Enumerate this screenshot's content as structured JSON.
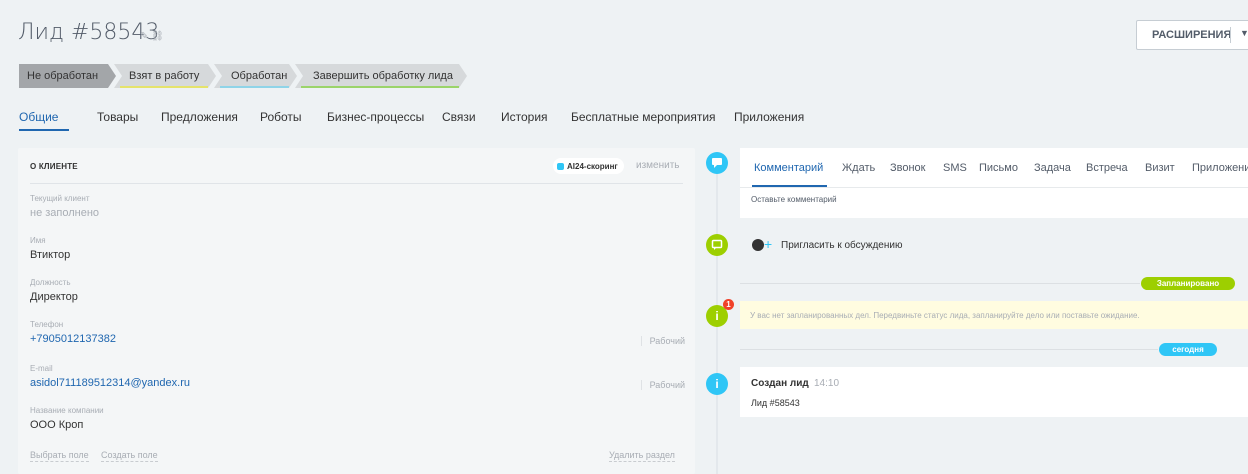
{
  "header": {
    "title": "Лид #58543",
    "extensions_button": "РАСШИРЕНИЯ"
  },
  "stages": [
    {
      "label": "Не обработан",
      "color": "#a3a6a9",
      "underline": "#a3a6a9",
      "current": true
    },
    {
      "label": "Взят в работу",
      "color": "#d6d9db",
      "underline": "#e5e36b"
    },
    {
      "label": "Обработан",
      "color": "#d6d9db",
      "underline": "#8fd4e8"
    },
    {
      "label": "Завершить обработку лида",
      "color": "#d6d9db",
      "underline": "#9bd46a"
    }
  ],
  "tabs": [
    {
      "label": "Общие",
      "active": true
    },
    {
      "label": "Товары"
    },
    {
      "label": "Предложения"
    },
    {
      "label": "Роботы"
    },
    {
      "label": "Бизнес-процессы"
    },
    {
      "label": "Связи"
    },
    {
      "label": "История"
    },
    {
      "label": "Бесплатные мероприятия"
    },
    {
      "label": "Приложения"
    }
  ],
  "client_card": {
    "title": "О КЛИЕНТЕ",
    "ai_badge": "AI24-скоринг",
    "change_link": "изменить",
    "fields": [
      {
        "label": "Текущий клиент",
        "value": "не заполнено"
      },
      {
        "label": "Имя",
        "value": "Втиктор"
      },
      {
        "label": "Должность",
        "value": "Директор"
      },
      {
        "label": "Телефон",
        "value": "+7905012137382",
        "type": "Рабочий"
      },
      {
        "label": "E-mail",
        "value": "asidol711189512314@yandex.ru",
        "type": "Рабочий"
      },
      {
        "label": "Название компании",
        "value": "ООО Кроп"
      }
    ],
    "select_field": "Выбрать поле",
    "create_field": "Создать поле",
    "delete_section": "Удалить раздел"
  },
  "timeline": {
    "editor_tabs": [
      "Комментарий",
      "Ждать",
      "Звонок",
      "SMS",
      "Письмо",
      "Задача",
      "Встреча",
      "Визит",
      "Приложени"
    ],
    "comment_placeholder": "Оставьте комментарий",
    "invite": "Пригласить к обсуждению",
    "planned_pill": "Запланировано",
    "warning_count": "1",
    "warning_text": "У вас нет запланированных дел. Передвиньте статус лида, запланируйте дело или поставьте ожидание.",
    "today_pill": "сегодня",
    "created_title": "Создан лид",
    "created_time": "14:10",
    "created_sub": "Лид #58543"
  },
  "colors": {
    "accent": "#2067b0",
    "timeline_blue": "#2fc6f6",
    "timeline_green": "#9dcf00",
    "warning_red": "#f0422a"
  }
}
